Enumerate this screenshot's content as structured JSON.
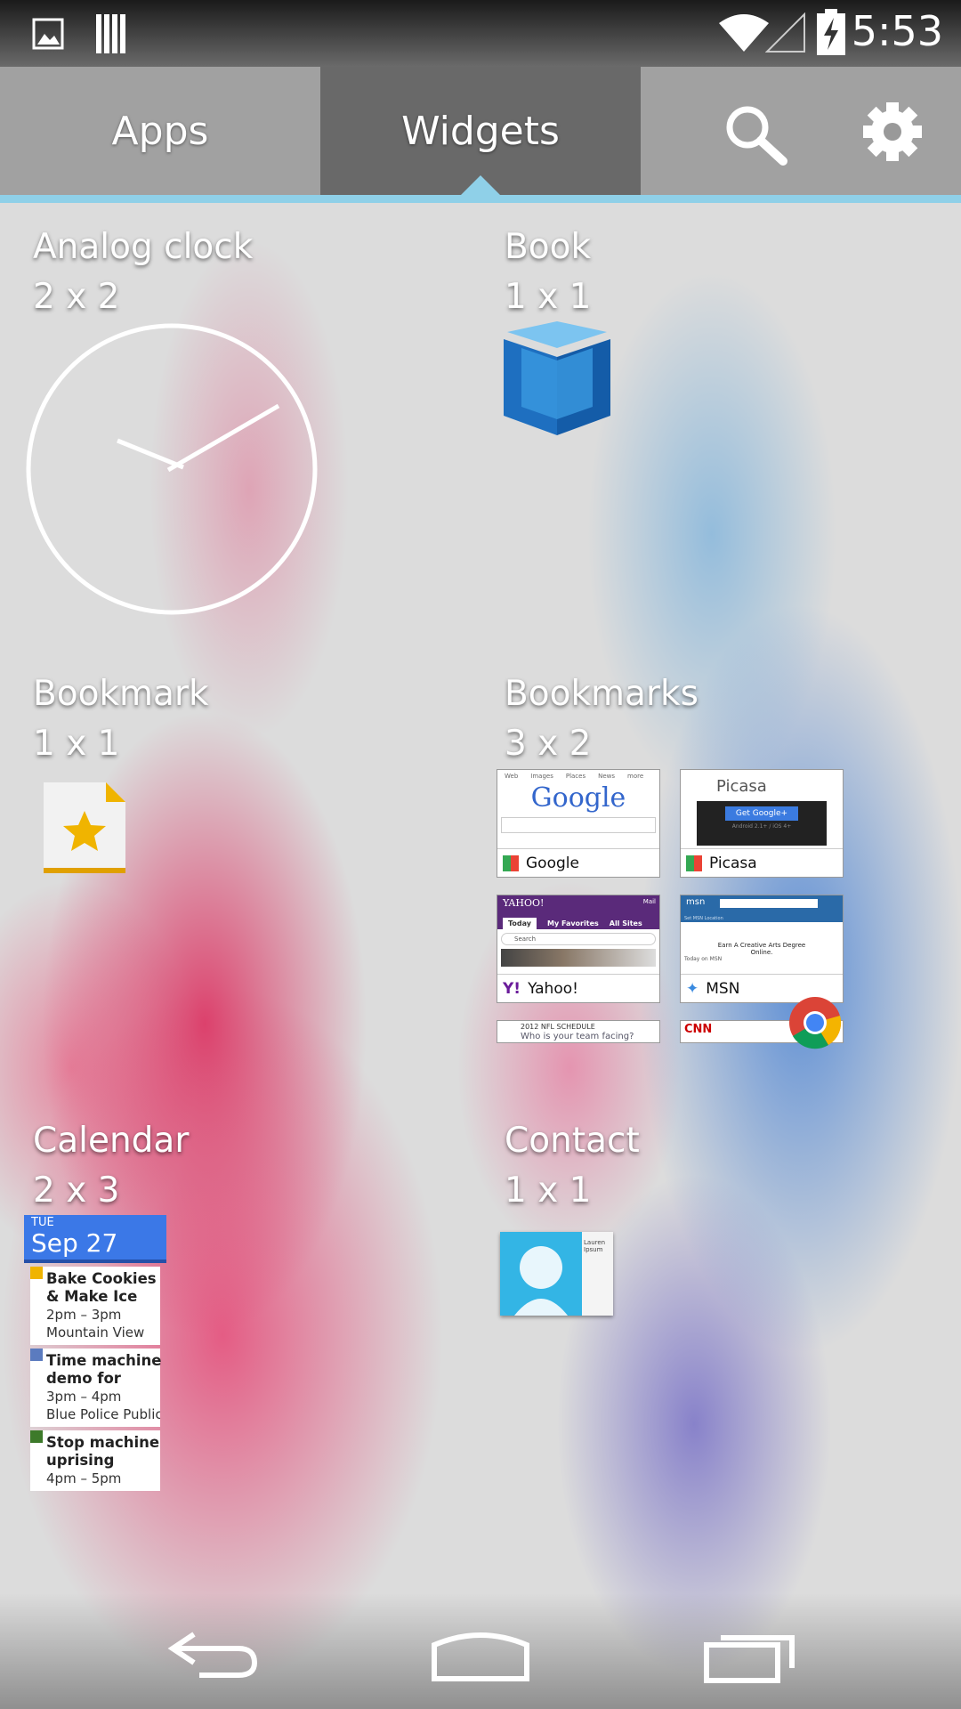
{
  "status_bar": {
    "time": "5:53",
    "icons": [
      "image-icon",
      "barcode-icon",
      "wifi-icon",
      "signal-icon",
      "battery-charging-icon"
    ]
  },
  "tabs": {
    "apps": "Apps",
    "widgets": "Widgets",
    "active": "Widgets",
    "search_icon": "search-icon",
    "settings_icon": "gear-icon"
  },
  "accent": "#8fd0e8",
  "widgets": [
    {
      "name": "Analog clock",
      "size": "2 x 2"
    },
    {
      "name": "Book",
      "size": "1 x 1"
    },
    {
      "name": "Bookmark",
      "size": "1 x 1"
    },
    {
      "name": "Bookmarks",
      "size": "3 x 2",
      "items": [
        {
          "title": "Google",
          "logo": "Google",
          "tabs": [
            "Web",
            "Images",
            "Places",
            "News",
            "more"
          ]
        },
        {
          "title": "Picasa",
          "logo": "Picasa",
          "button": "Get Google+",
          "note": "Android 2.1+ / iOS 4+"
        },
        {
          "title": "Yahoo!",
          "logo": "YAHOO!",
          "mail": "Mail",
          "tabs": [
            "Today",
            "My Favorites",
            "All Sites"
          ],
          "search": "Search"
        },
        {
          "title": "MSN",
          "logo": "msn",
          "location": "Set MSN Location",
          "ad": "Earn A Creative Arts Degree Online.",
          "today": "Today on MSN"
        },
        {
          "title": "2012 NFL SCHEDULE",
          "subtitle": "Who is your team facing?"
        },
        {
          "title": "CNN"
        }
      ]
    },
    {
      "name": "Calendar",
      "size": "2 x 3",
      "day": "TUE",
      "date": "Sep 27",
      "events": [
        {
          "title": "Bake Cookies & Make Ice Cream",
          "time": "2pm – 3pm",
          "location": "Mountain View",
          "color": "#f0b400"
        },
        {
          "title": "Time machine demo for Sergey",
          "time": "3pm – 4pm",
          "location": "Blue Police Public",
          "color": "#5b7bbf"
        },
        {
          "title": "Stop machine uprising",
          "time": "4pm – 5pm",
          "color": "#3d7a2a"
        }
      ]
    },
    {
      "name": "Contact",
      "size": "1 x 1",
      "contact_name": "Lauren Ipsum"
    }
  ],
  "nav": {
    "back": "back-icon",
    "home": "home-icon",
    "recents": "recents-icon"
  }
}
